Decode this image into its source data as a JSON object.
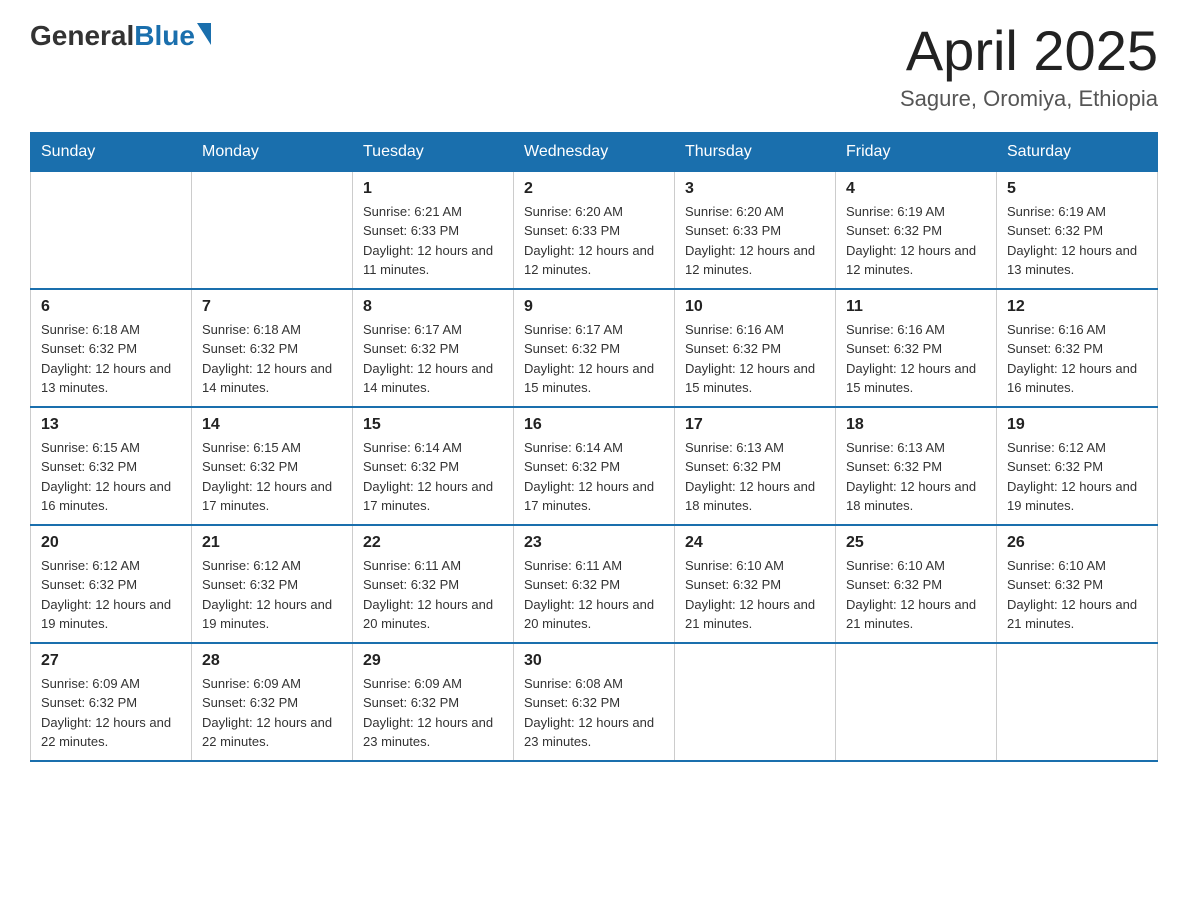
{
  "header": {
    "logo_general": "General",
    "logo_blue": "Blue",
    "month_title": "April 2025",
    "location": "Sagure, Oromiya, Ethiopia"
  },
  "days_of_week": [
    "Sunday",
    "Monday",
    "Tuesday",
    "Wednesday",
    "Thursday",
    "Friday",
    "Saturday"
  ],
  "weeks": [
    [
      {
        "day": "",
        "sunrise": "",
        "sunset": "",
        "daylight": ""
      },
      {
        "day": "",
        "sunrise": "",
        "sunset": "",
        "daylight": ""
      },
      {
        "day": "1",
        "sunrise": "Sunrise: 6:21 AM",
        "sunset": "Sunset: 6:33 PM",
        "daylight": "Daylight: 12 hours and 11 minutes."
      },
      {
        "day": "2",
        "sunrise": "Sunrise: 6:20 AM",
        "sunset": "Sunset: 6:33 PM",
        "daylight": "Daylight: 12 hours and 12 minutes."
      },
      {
        "day": "3",
        "sunrise": "Sunrise: 6:20 AM",
        "sunset": "Sunset: 6:33 PM",
        "daylight": "Daylight: 12 hours and 12 minutes."
      },
      {
        "day": "4",
        "sunrise": "Sunrise: 6:19 AM",
        "sunset": "Sunset: 6:32 PM",
        "daylight": "Daylight: 12 hours and 12 minutes."
      },
      {
        "day": "5",
        "sunrise": "Sunrise: 6:19 AM",
        "sunset": "Sunset: 6:32 PM",
        "daylight": "Daylight: 12 hours and 13 minutes."
      }
    ],
    [
      {
        "day": "6",
        "sunrise": "Sunrise: 6:18 AM",
        "sunset": "Sunset: 6:32 PM",
        "daylight": "Daylight: 12 hours and 13 minutes."
      },
      {
        "day": "7",
        "sunrise": "Sunrise: 6:18 AM",
        "sunset": "Sunset: 6:32 PM",
        "daylight": "Daylight: 12 hours and 14 minutes."
      },
      {
        "day": "8",
        "sunrise": "Sunrise: 6:17 AM",
        "sunset": "Sunset: 6:32 PM",
        "daylight": "Daylight: 12 hours and 14 minutes."
      },
      {
        "day": "9",
        "sunrise": "Sunrise: 6:17 AM",
        "sunset": "Sunset: 6:32 PM",
        "daylight": "Daylight: 12 hours and 15 minutes."
      },
      {
        "day": "10",
        "sunrise": "Sunrise: 6:16 AM",
        "sunset": "Sunset: 6:32 PM",
        "daylight": "Daylight: 12 hours and 15 minutes."
      },
      {
        "day": "11",
        "sunrise": "Sunrise: 6:16 AM",
        "sunset": "Sunset: 6:32 PM",
        "daylight": "Daylight: 12 hours and 15 minutes."
      },
      {
        "day": "12",
        "sunrise": "Sunrise: 6:16 AM",
        "sunset": "Sunset: 6:32 PM",
        "daylight": "Daylight: 12 hours and 16 minutes."
      }
    ],
    [
      {
        "day": "13",
        "sunrise": "Sunrise: 6:15 AM",
        "sunset": "Sunset: 6:32 PM",
        "daylight": "Daylight: 12 hours and 16 minutes."
      },
      {
        "day": "14",
        "sunrise": "Sunrise: 6:15 AM",
        "sunset": "Sunset: 6:32 PM",
        "daylight": "Daylight: 12 hours and 17 minutes."
      },
      {
        "day": "15",
        "sunrise": "Sunrise: 6:14 AM",
        "sunset": "Sunset: 6:32 PM",
        "daylight": "Daylight: 12 hours and 17 minutes."
      },
      {
        "day": "16",
        "sunrise": "Sunrise: 6:14 AM",
        "sunset": "Sunset: 6:32 PM",
        "daylight": "Daylight: 12 hours and 17 minutes."
      },
      {
        "day": "17",
        "sunrise": "Sunrise: 6:13 AM",
        "sunset": "Sunset: 6:32 PM",
        "daylight": "Daylight: 12 hours and 18 minutes."
      },
      {
        "day": "18",
        "sunrise": "Sunrise: 6:13 AM",
        "sunset": "Sunset: 6:32 PM",
        "daylight": "Daylight: 12 hours and 18 minutes."
      },
      {
        "day": "19",
        "sunrise": "Sunrise: 6:12 AM",
        "sunset": "Sunset: 6:32 PM",
        "daylight": "Daylight: 12 hours and 19 minutes."
      }
    ],
    [
      {
        "day": "20",
        "sunrise": "Sunrise: 6:12 AM",
        "sunset": "Sunset: 6:32 PM",
        "daylight": "Daylight: 12 hours and 19 minutes."
      },
      {
        "day": "21",
        "sunrise": "Sunrise: 6:12 AM",
        "sunset": "Sunset: 6:32 PM",
        "daylight": "Daylight: 12 hours and 19 minutes."
      },
      {
        "day": "22",
        "sunrise": "Sunrise: 6:11 AM",
        "sunset": "Sunset: 6:32 PM",
        "daylight": "Daylight: 12 hours and 20 minutes."
      },
      {
        "day": "23",
        "sunrise": "Sunrise: 6:11 AM",
        "sunset": "Sunset: 6:32 PM",
        "daylight": "Daylight: 12 hours and 20 minutes."
      },
      {
        "day": "24",
        "sunrise": "Sunrise: 6:10 AM",
        "sunset": "Sunset: 6:32 PM",
        "daylight": "Daylight: 12 hours and 21 minutes."
      },
      {
        "day": "25",
        "sunrise": "Sunrise: 6:10 AM",
        "sunset": "Sunset: 6:32 PM",
        "daylight": "Daylight: 12 hours and 21 minutes."
      },
      {
        "day": "26",
        "sunrise": "Sunrise: 6:10 AM",
        "sunset": "Sunset: 6:32 PM",
        "daylight": "Daylight: 12 hours and 21 minutes."
      }
    ],
    [
      {
        "day": "27",
        "sunrise": "Sunrise: 6:09 AM",
        "sunset": "Sunset: 6:32 PM",
        "daylight": "Daylight: 12 hours and 22 minutes."
      },
      {
        "day": "28",
        "sunrise": "Sunrise: 6:09 AM",
        "sunset": "Sunset: 6:32 PM",
        "daylight": "Daylight: 12 hours and 22 minutes."
      },
      {
        "day": "29",
        "sunrise": "Sunrise: 6:09 AM",
        "sunset": "Sunset: 6:32 PM",
        "daylight": "Daylight: 12 hours and 23 minutes."
      },
      {
        "day": "30",
        "sunrise": "Sunrise: 6:08 AM",
        "sunset": "Sunset: 6:32 PM",
        "daylight": "Daylight: 12 hours and 23 minutes."
      },
      {
        "day": "",
        "sunrise": "",
        "sunset": "",
        "daylight": ""
      },
      {
        "day": "",
        "sunrise": "",
        "sunset": "",
        "daylight": ""
      },
      {
        "day": "",
        "sunrise": "",
        "sunset": "",
        "daylight": ""
      }
    ]
  ]
}
